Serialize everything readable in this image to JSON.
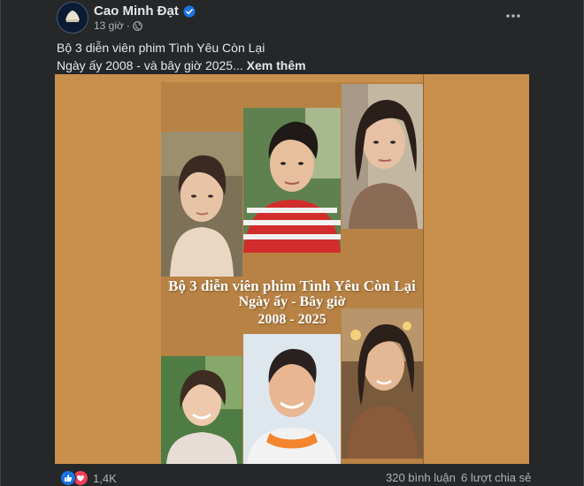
{
  "post": {
    "author": "Cao Minh Đạt",
    "time": "13 giờ",
    "separator": "·",
    "caption_line1": "Bộ 3 diễn viên phim Tình Yêu Còn Lại",
    "caption_line2": "Ngày ấy 2008 - và bây giờ 2025...",
    "see_more": "Xem thêm"
  },
  "image": {
    "title_line1": "Bộ 3 diễn viên phim Tình Yêu Còn Lại",
    "title_line2": "Ngày ấy - Bây giờ",
    "title_line3": "2008 - 2025",
    "background_color": "#c98f4d"
  },
  "footer": {
    "reaction_count": "1,4K",
    "comments": "320 bình luận",
    "shares": "6 lượt chia sẻ"
  },
  "colors": {
    "background": "#252728",
    "text_primary": "#e4e6eb",
    "text_secondary": "#b0b3b8",
    "verified": "#1b74e4",
    "like": "#1b74e4",
    "love": "#f33e58"
  },
  "icons": {
    "verified": "verified-badge-icon",
    "privacy": "globe-icon",
    "more": "more-options-icon",
    "like": "like-reaction-icon",
    "love": "love-reaction-icon"
  }
}
